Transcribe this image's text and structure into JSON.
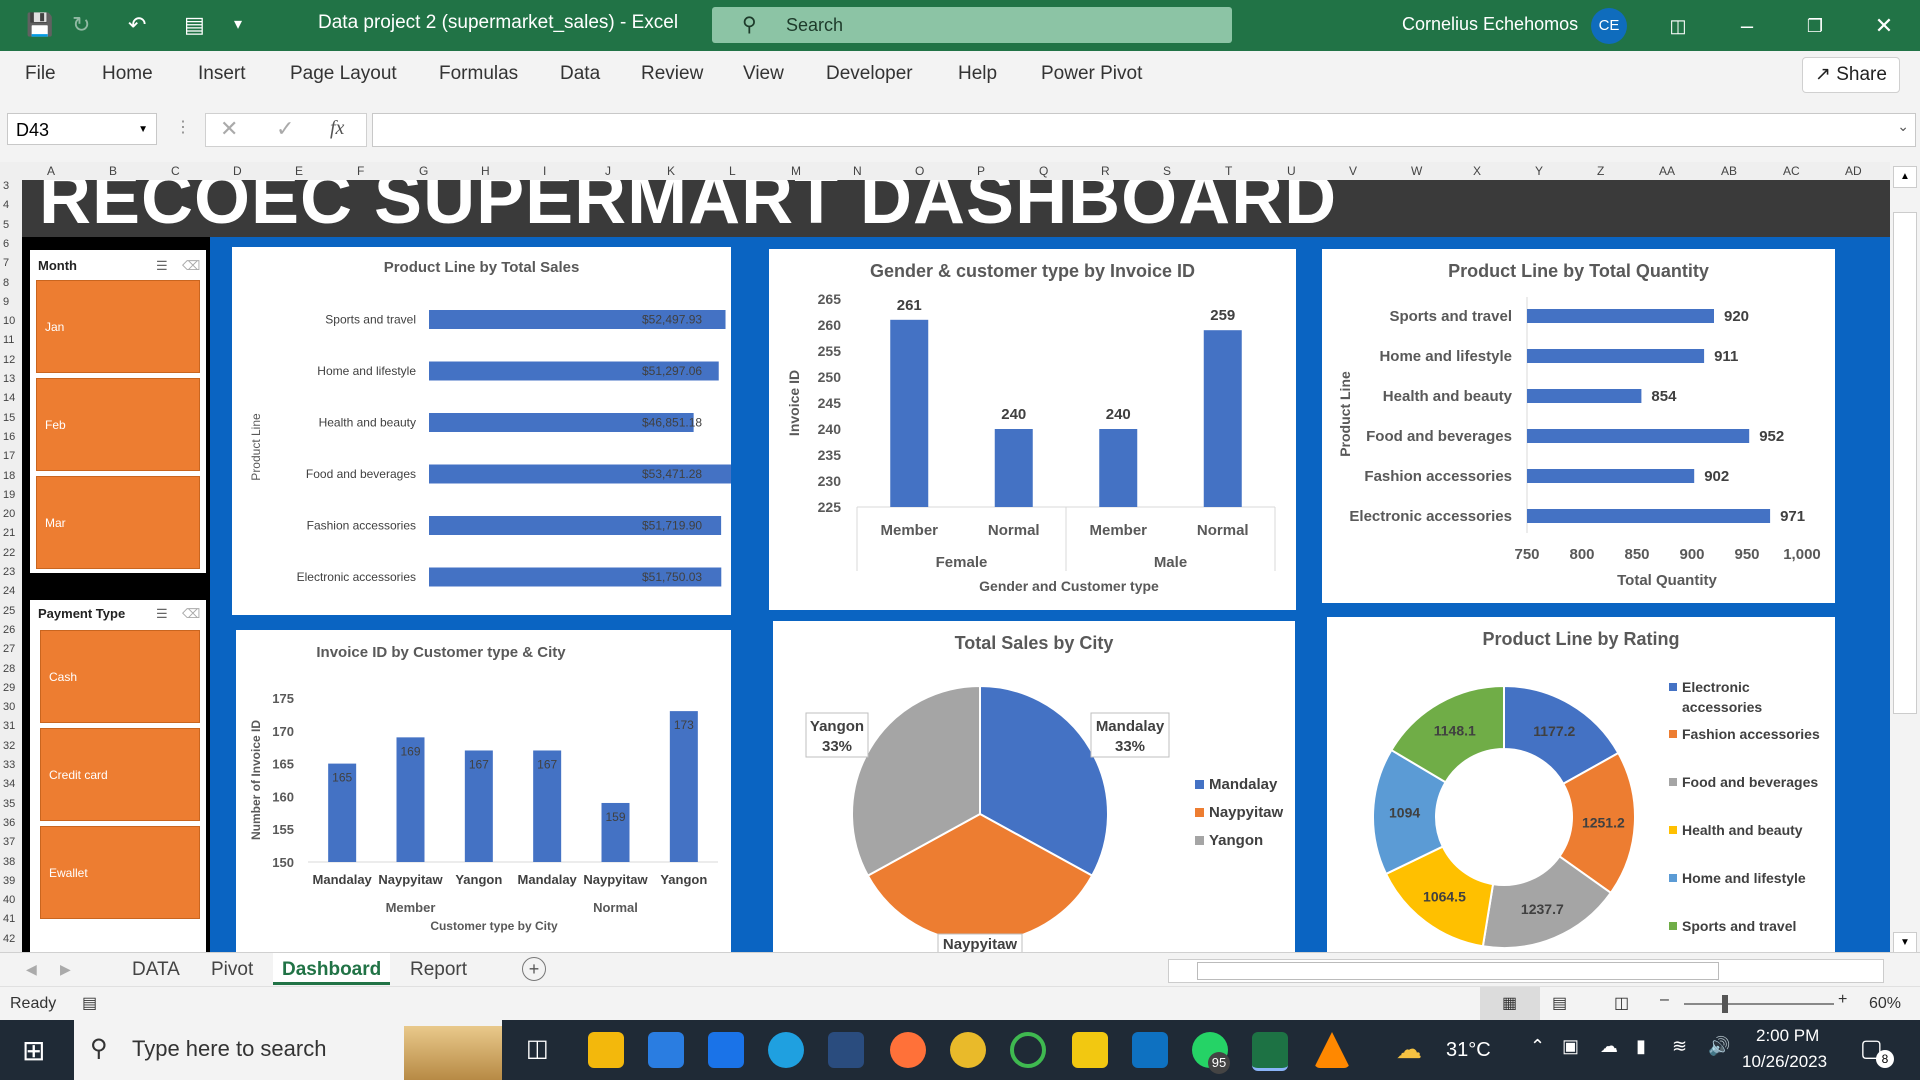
{
  "titlebar": {
    "title": "Data project 2 (supermarket_sales)  -  Excel",
    "search_placeholder": "Search",
    "user": "Cornelius Echehomos",
    "initials": "CE"
  },
  "ribbon": {
    "tabs": [
      "File",
      "Home",
      "Insert",
      "Page Layout",
      "Formulas",
      "Data",
      "Review",
      "View",
      "Developer",
      "Help",
      "Power Pivot"
    ],
    "share": "Share"
  },
  "formula_bar": {
    "name_box": "D43",
    "fx": "fx"
  },
  "columns": [
    "A",
    "B",
    "C",
    "D",
    "E",
    "F",
    "G",
    "H",
    "I",
    "J",
    "K",
    "L",
    "M",
    "N",
    "O",
    "P",
    "Q",
    "R",
    "S",
    "T",
    "U",
    "V",
    "W",
    "X",
    "Y",
    "Z",
    "AA",
    "AB",
    "AC",
    "AD"
  ],
  "rows": [
    "3",
    "4",
    "5",
    "6",
    "7",
    "8",
    "9",
    "10",
    "11",
    "12",
    "13",
    "14",
    "15",
    "16",
    "17",
    "18",
    "19",
    "20",
    "21",
    "22",
    "23",
    "24",
    "25",
    "26",
    "27",
    "28",
    "29",
    "30",
    "31",
    "32",
    "33",
    "34",
    "35",
    "36",
    "37",
    "38",
    "39",
    "40",
    "41",
    "42"
  ],
  "dashboard_title": "RECOEC SUPERMART DASHBOARD",
  "slicers": {
    "month": {
      "title": "Month",
      "items": [
        "Jan",
        "Feb",
        "Mar"
      ]
    },
    "payment": {
      "title": "Payment Type",
      "items": [
        "Cash",
        "Credit card",
        "Ewallet"
      ]
    }
  },
  "chart_data": [
    {
      "type": "bar",
      "title": "Product Line by Total Sales",
      "ylabel": "Product Line",
      "categories": [
        "Sports and travel",
        "Home and lifestyle",
        "Health and beauty",
        "Food and beverages",
        "Fashion accessories",
        "Electronic accessories"
      ],
      "values": [
        52497.93,
        51297.06,
        46851.18,
        53471.28,
        51719.9,
        51750.03
      ],
      "labels": [
        "$52,497.93",
        "$51,297.06",
        "$46,851.18",
        "$53,471.28",
        "$51,719.90",
        "$51,750.03"
      ]
    },
    {
      "type": "bar",
      "title": "Gender & customer type by Invoice ID",
      "ylabel": "Invoice ID",
      "xlabel": "Gender and Customer type",
      "categories": [
        "Member",
        "Normal",
        "Member",
        "Normal"
      ],
      "groups": [
        "Female",
        "Male"
      ],
      "values": [
        261,
        240,
        240,
        259
      ],
      "ylim": [
        225,
        265
      ],
      "yticks": [
        "265",
        "260",
        "255",
        "250",
        "245",
        "240",
        "235",
        "230",
        "225"
      ]
    },
    {
      "type": "bar",
      "title": "Product Line by Total Quantity",
      "ylabel": "Product Line",
      "xlabel": "Total Quantity",
      "categories": [
        "Sports and travel",
        "Home and lifestyle",
        "Health and beauty",
        "Food and beverages",
        "Fashion accessories",
        "Electronic accessories"
      ],
      "values": [
        920,
        911,
        854,
        952,
        902,
        971
      ],
      "xlim": [
        750,
        1000
      ],
      "xticks": [
        "750",
        "800",
        "850",
        "900",
        "950",
        "1,000"
      ]
    },
    {
      "type": "bar",
      "title": "Invoice ID by Customer type & City",
      "ylabel": "Number of Invoice ID",
      "xlabel": "Customer type by City",
      "categories": [
        "Mandalay",
        "Naypyitaw",
        "Yangon",
        "Mandalay",
        "Naypyitaw",
        "Yangon"
      ],
      "groups": [
        "Member",
        "Normal"
      ],
      "values": [
        165,
        169,
        167,
        167,
        159,
        173
      ],
      "ylim": [
        150,
        175
      ],
      "yticks": [
        "175",
        "170",
        "165",
        "160",
        "155",
        "150"
      ]
    },
    {
      "type": "pie",
      "title": "Total Sales by City",
      "categories": [
        "Mandalay",
        "Naypyitaw",
        "Yangon"
      ],
      "values": [
        33,
        34,
        33
      ],
      "labels": [
        "Mandalay\n33%",
        "Naypyitaw",
        "Yangon\n33%"
      ],
      "colors": [
        "#4472c4",
        "#ed7d31",
        "#a5a5a5"
      ]
    },
    {
      "type": "pie",
      "title": "Product Line by Rating",
      "categories": [
        "Electronic accessories",
        "Fashion accessories",
        "Food and beverages",
        "Health and beauty",
        "Home and lifestyle",
        "Sports and travel"
      ],
      "values": [
        1177.2,
        1251.2,
        1237.7,
        1064.5,
        1094,
        1148.1
      ],
      "labels": [
        "1177.2",
        "1251.2",
        "1237.7",
        "1064.5",
        "1094",
        "1148.1"
      ],
      "colors": [
        "#4472c4",
        "#ed7d31",
        "#a5a5a5",
        "#ffc000",
        "#5b9bd5",
        "#70ad47"
      ]
    }
  ],
  "sheets": {
    "tabs": [
      "DATA",
      "Pivot",
      "Dashboard",
      "Report"
    ],
    "active": "Dashboard"
  },
  "status": {
    "ready": "Ready",
    "zoom": "60%"
  },
  "taskbar": {
    "search": "Type here to search",
    "weather": "31°C",
    "time": "2:00 PM",
    "date": "10/26/2023",
    "whatsapp_badge": "95",
    "notif": "8"
  },
  "colors": {
    "accent": "#217346",
    "bar": "#4472c4",
    "slicer": "#ed7d31",
    "dashbg": "#0a64c2"
  }
}
